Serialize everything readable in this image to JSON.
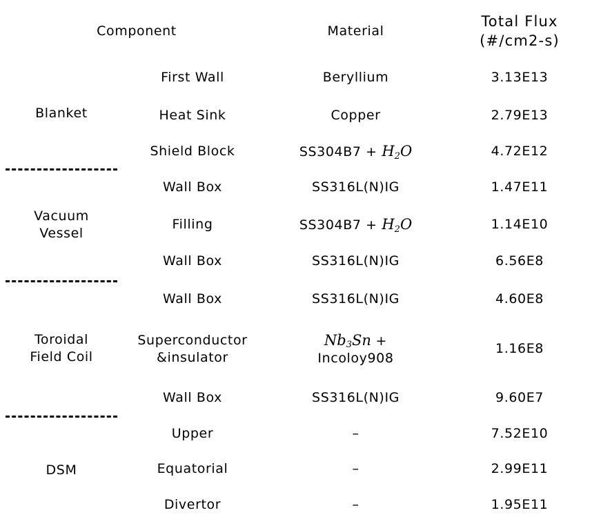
{
  "table": {
    "headers": {
      "component": "Component",
      "material": "Material",
      "total_flux_line1": "Total Flux",
      "total_flux_line2": "(#/cm2-s)"
    },
    "groups": [
      {
        "name": "Blanket",
        "name_lines": [
          "Blanket"
        ],
        "rows": [
          {
            "component": "First Wall",
            "material_text": "Beryllium",
            "material_prefix": "Beryllium",
            "material_formula": "",
            "flux": "3.13E13"
          },
          {
            "component": "Heat Sink",
            "material_text": "Copper",
            "material_prefix": "Copper",
            "material_formula": "",
            "flux": "2.79E13"
          },
          {
            "component": "Shield Block",
            "material_text": "SS304B7 + H2O",
            "material_prefix": "SS304B7 + ",
            "material_formula": "H2O",
            "flux": "4.72E12"
          }
        ]
      },
      {
        "name": "Vacuum Vessel",
        "name_lines": [
          "Vacuum",
          "Vessel"
        ],
        "rows": [
          {
            "component": "Wall Box",
            "material_text": "SS316L(N)IG",
            "material_prefix": "SS316L(N)IG",
            "material_formula": "",
            "flux": "1.47E11"
          },
          {
            "component": "Filling",
            "material_text": "SS304B7 + H2O",
            "material_prefix": "SS304B7 + ",
            "material_formula": "H2O",
            "flux": "1.14E10"
          },
          {
            "component": "Wall Box",
            "material_text": "SS316L(N)IG",
            "material_prefix": "SS316L(N)IG",
            "material_formula": "",
            "flux": "6.56E8"
          }
        ]
      },
      {
        "name": "Toroidal Field Coil",
        "name_lines": [
          "Toroidal",
          "Field Coil"
        ],
        "rows": [
          {
            "component": "Wall Box",
            "material_text": "SS316L(N)IG",
            "material_prefix": "SS316L(N)IG",
            "material_formula": "",
            "flux": "4.60E8"
          },
          {
            "component": "Superconductor &insulator",
            "component_lines": [
              "Superconductor",
              "&insulator"
            ],
            "material_text": "Nb3Sn + Incoloy908",
            "material_formula": "Nb3Sn",
            "material_plus": " +",
            "material_second_line": "Incoloy908",
            "flux": "1.16E8"
          },
          {
            "component": "Wall Box",
            "material_text": "SS316L(N)IG",
            "material_prefix": "SS316L(N)IG",
            "material_formula": "",
            "flux": "9.60E7"
          }
        ]
      },
      {
        "name": "DSM",
        "name_lines": [
          "DSM"
        ],
        "rows": [
          {
            "component": "Upper",
            "material_text": "-",
            "material_prefix": "–",
            "material_formula": "",
            "flux": "7.52E10"
          },
          {
            "component": "Equatorial",
            "material_text": "-",
            "material_prefix": "–",
            "material_formula": "",
            "flux": "2.99E11"
          },
          {
            "component": "Divertor",
            "material_text": "-",
            "material_prefix": "–",
            "material_formula": "",
            "flux": "1.95E11"
          }
        ]
      }
    ]
  },
  "colors": {
    "border": "#000000",
    "text": "#000000",
    "background": "#ffffff"
  }
}
